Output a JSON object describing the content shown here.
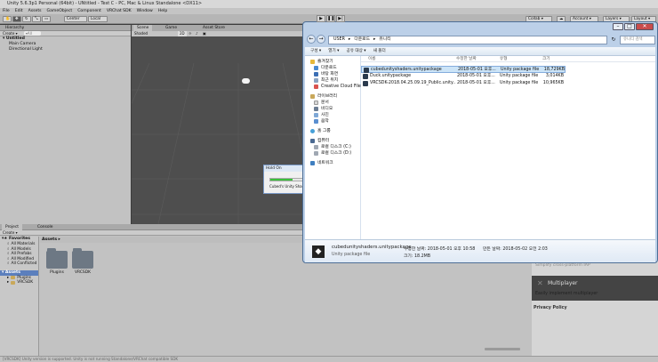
{
  "window": {
    "title": "Unity 5.6.3p1 Personal (64bit) - UNtitled - Test C - PC, Mac & Linux Standalone <DX11>"
  },
  "menu": [
    "File",
    "Edit",
    "Assets",
    "GameObject",
    "Component",
    "VRChat SDK",
    "Window",
    "Help"
  ],
  "toolbar": {
    "center": "Center",
    "local": "Local",
    "collab": "Collab ▾",
    "account": "Account ▾",
    "layers": "Layers ▾",
    "layout": "Layout ▾"
  },
  "hierarchy": {
    "tab": "Hierarchy",
    "create": "Create ▾",
    "search": "▾All",
    "scene": "Untitled",
    "items": [
      "Main Camera",
      "Directional Light"
    ]
  },
  "scene": {
    "tabs": [
      "Scene",
      "Game",
      "Asset Store"
    ],
    "shading": "Shaded",
    "mode": "2D"
  },
  "holdon": {
    "title": "Hold On",
    "text": "Cubed's Unity Shade"
  },
  "project": {
    "tabs": [
      "Project",
      "Console"
    ],
    "create": "Create ▾",
    "favorites_label": "Favorites",
    "favorites": [
      "All Materials",
      "All Models",
      "All Prefabs",
      "All Modified",
      "All Conflicted"
    ],
    "assets_label": "Assets",
    "asset_tree": [
      "Plugins",
      "VRCSDK"
    ],
    "breadcrumb": "Assets ▸",
    "folders": [
      "Plugins",
      "VRCSDK"
    ]
  },
  "inspector": {
    "faded_text": "Simplify cross-platform IAP",
    "multiplayer_title": "Multiplayer",
    "multiplayer_desc": "Easily implement multiplayer",
    "privacy": "Privacy Policy"
  },
  "status": "[VRCSDK] Unity version is supported. Unity is not running Standalone/VRChat compatible SDK",
  "explorer": {
    "path": [
      "USER",
      "▸",
      "다운로드",
      "▸",
      "유니티"
    ],
    "search_placeholder": "유니티 검색",
    "commands": [
      "구성 ▾",
      "열기 ▾",
      "공유 대상 ▾",
      "새 폴더"
    ],
    "nav": {
      "favorites": "즐겨찾기",
      "fav_items": [
        "다운로드",
        "바탕 화면",
        "최근 위치",
        "Creative Cloud Files"
      ],
      "libraries": "라이브러리",
      "lib_items": [
        "문서",
        "비디오",
        "사진",
        "음악"
      ],
      "homegroup": "홈 그룹",
      "computer": "컴퓨터",
      "drives": [
        "로컬 디스크 (C:)",
        "로컬 디스크 (D:)"
      ],
      "network": "네트워크"
    },
    "columns": [
      "이름",
      "수정한 날짜",
      "유형",
      "크기"
    ],
    "files": [
      {
        "name": "cubedunityshaders.unitypackage",
        "date": "2018-05-01 오후...",
        "type": "Unity package file",
        "size": "18,729KB"
      },
      {
        "name": "Duck.unitypackage",
        "date": "2018-05-01 오후...",
        "type": "Unity package file",
        "size": "3,014KB"
      },
      {
        "name": "VRCSDK-2018.04.25.09.19_Public.unity...",
        "date": "2018-05-01 오후...",
        "type": "Unity package file",
        "size": "10,965KB"
      }
    ],
    "details": {
      "name": "cubedunityshaders.unitypackage",
      "modified": "수정한 날짜: 2018-05-01 오후 10:58",
      "created": "만든 날짜: 2018-05-02 오전 2:03",
      "type": "Unity package file",
      "size": "크기: 18.2MB"
    }
  }
}
